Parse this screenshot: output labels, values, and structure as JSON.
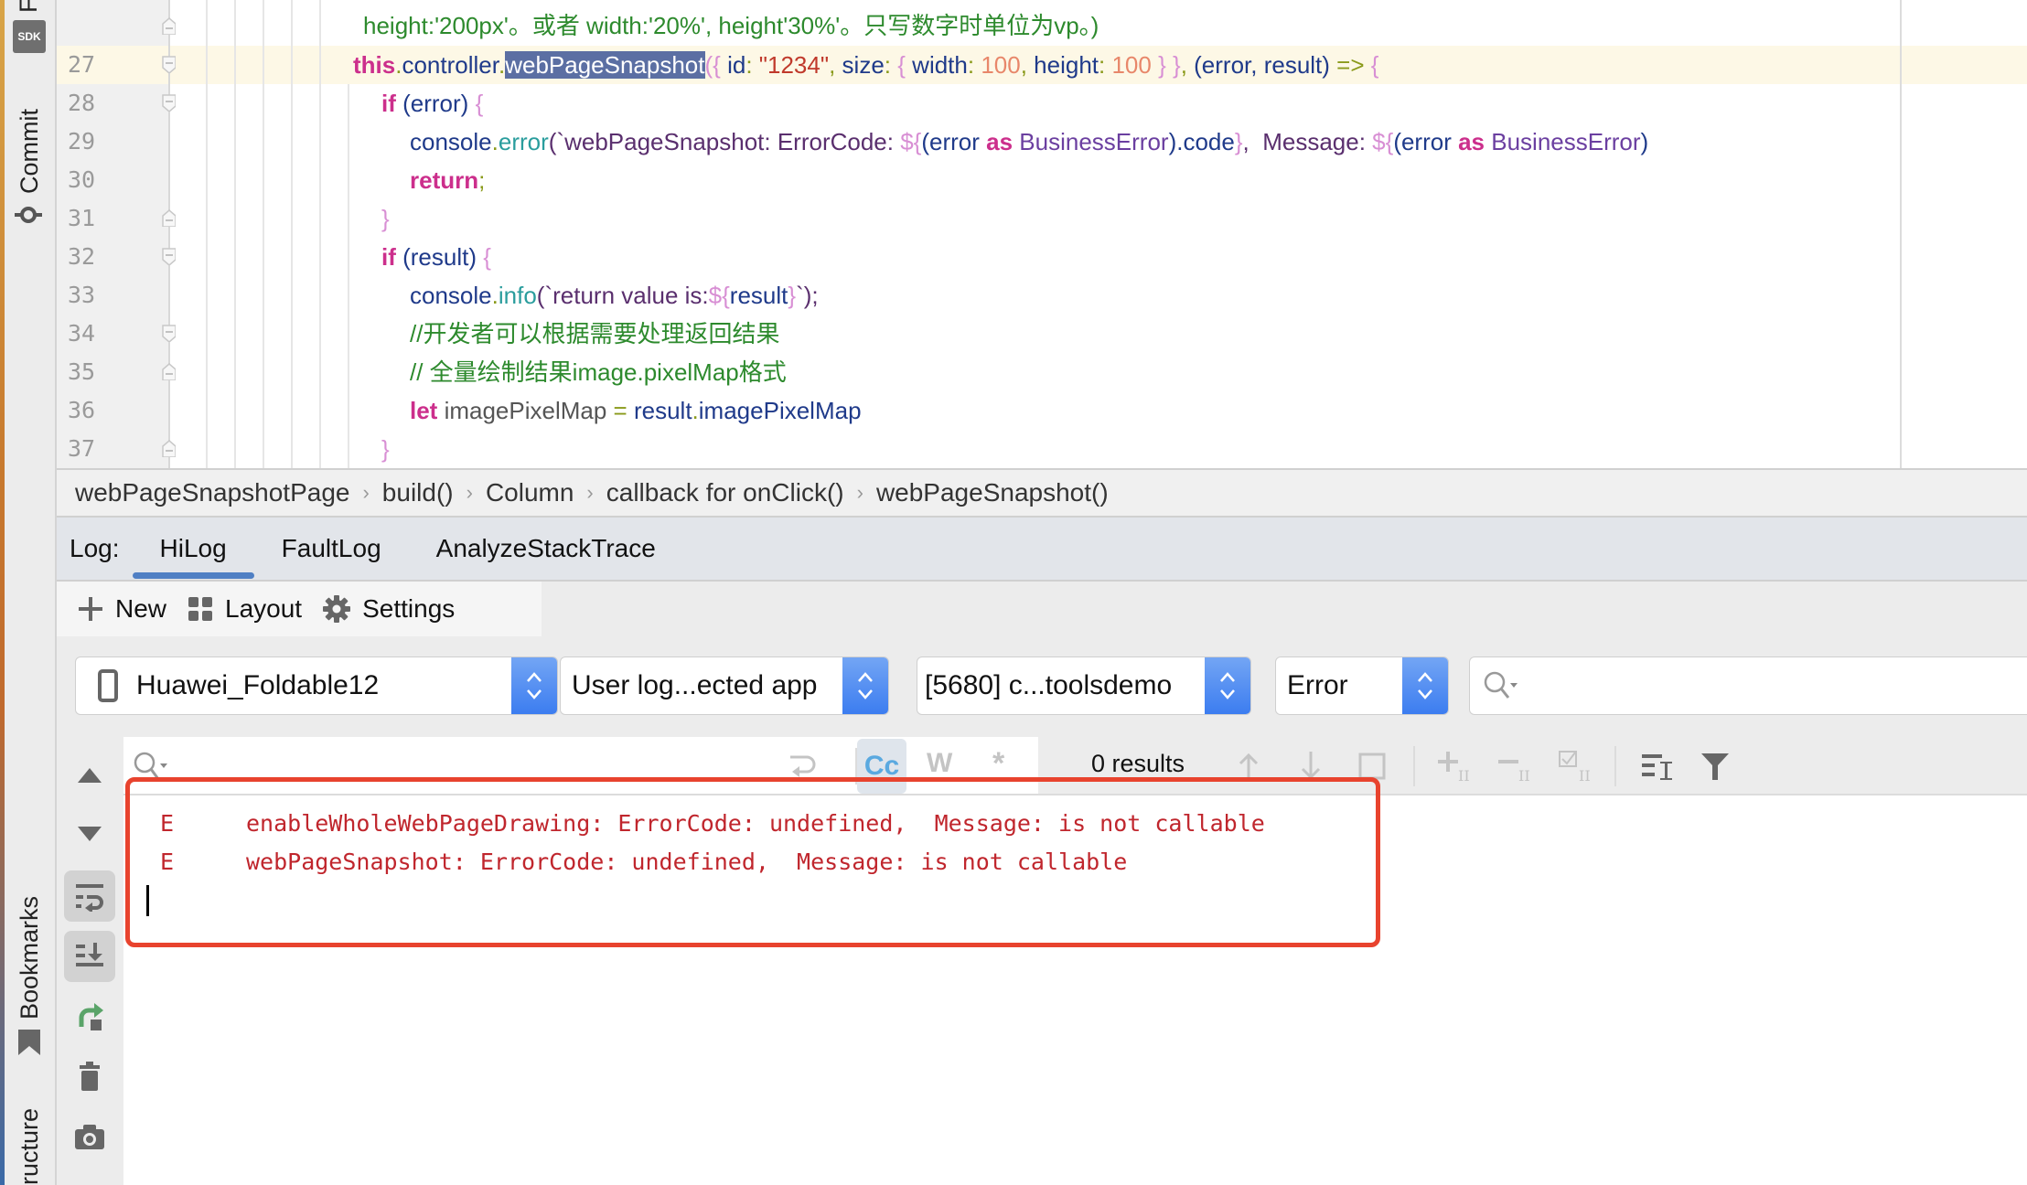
{
  "sidebar": {
    "top_partial_label": "F",
    "sdk_badge": "SDK",
    "commit_label": "Commit",
    "bookmarks_label": "Bookmarks",
    "structure_label": "ructure"
  },
  "editor": {
    "line_numbers": [
      "27",
      "28",
      "29",
      "30",
      "31",
      "32",
      "33",
      "34",
      "35",
      "36",
      "37"
    ],
    "current_line": "27",
    "comment_top": "height:'200px'。或者 width:'20%', height'30%'。只写数字时单位为vp。)",
    "line27": {
      "this": "this",
      "dot1": ".",
      "controller": "controller",
      "dot2": ".",
      "selected": "webPageSnapshot",
      "open": "({ ",
      "id_key": "id",
      "colon1": ": ",
      "id_val": "\"1234\"",
      "comma1": ", ",
      "size_key": "size",
      "colon2": ": ",
      "brace_open": "{ ",
      "w_key": "width",
      "colon3": ": ",
      "w_val": "100",
      "comma2": ", ",
      "h_key": "height",
      "colon4": ": ",
      "h_val": "100",
      "close": " } }",
      "comma3": ", ",
      "params": "(error, result)",
      "arrow": " => ",
      "brace_final": "{"
    },
    "line28": {
      "kw": "if",
      "rest": " (error) ",
      "brace": "{"
    },
    "line29": {
      "obj": "console",
      "dot": ".",
      "fn": "error",
      "open": "(`",
      "tpl1": "webPageSnapshot: ErrorCode: ",
      "expr1_open": "${",
      "expr1_a": "(error ",
      "as1": "as",
      "type1": " BusinessError",
      "expr1_b": ").code",
      "expr1_close": "}",
      "tpl2": ",  Message: ",
      "expr2_open": "${",
      "expr2_a": "(error ",
      "as2": "as",
      "type2": " BusinessError",
      "expr2_b": ")"
    },
    "line30": {
      "kw": "return",
      "semi": ";"
    },
    "line31": {
      "brace": "}"
    },
    "line32": {
      "kw": "if",
      "rest": " (result) ",
      "brace": "{"
    },
    "line33": {
      "obj": "console",
      "dot": ".",
      "fn": "info",
      "open": "(`",
      "tpl": "return value is:",
      "expr_open": "${",
      "expr": "result",
      "expr_close": "}",
      "close": "`);"
    },
    "line34": {
      "comment": "//开发者可以根据需要处理返回结果"
    },
    "line35": {
      "comment": "// 全量绘制结果image.pixelMap格式"
    },
    "line36": {
      "kw": "let",
      "var": " imagePixelMap",
      "eq": " = ",
      "obj": "result",
      "dot": ".",
      "prop": "imagePixelMap"
    },
    "line37": {
      "brace": "}"
    }
  },
  "breadcrumb": {
    "items": [
      "webPageSnapshotPage",
      "build()",
      "Column",
      "callback for onClick()",
      "webPageSnapshot()"
    ],
    "separator": "›"
  },
  "log_panel": {
    "label": "Log:",
    "tabs": [
      {
        "label": "HiLog",
        "active": true
      },
      {
        "label": "FaultLog",
        "active": false
      },
      {
        "label": "AnalyzeStackTrace",
        "active": false
      }
    ],
    "toolbar": {
      "new_label": "New",
      "layout_label": "Layout",
      "settings_label": "Settings"
    },
    "filters": {
      "device": "Huawei_Foldable12",
      "log_scope": "User log...ected app",
      "process": "[5680] c...toolsdemo",
      "level": "Error",
      "search_value": ""
    },
    "search": {
      "value": "",
      "match_case_label": "Cc",
      "words_label": "W",
      "regex_label": "*",
      "results": "0 results"
    },
    "entries": [
      {
        "level": "E",
        "message": "enableWholeWebPageDrawing: ErrorCode: undefined,  Message: is not callable"
      },
      {
        "level": "E",
        "message": "webPageSnapshot: ErrorCode: undefined,  Message: is not callable"
      }
    ]
  },
  "colors": {
    "highlight_box": "#e8432e",
    "active_tab_indicator": "#4f7fc4",
    "error_text": "#c0262d",
    "combo_arrow": "#3b7cf0",
    "selection": "#5b6fa3",
    "current_line": "#fdf8e6"
  }
}
